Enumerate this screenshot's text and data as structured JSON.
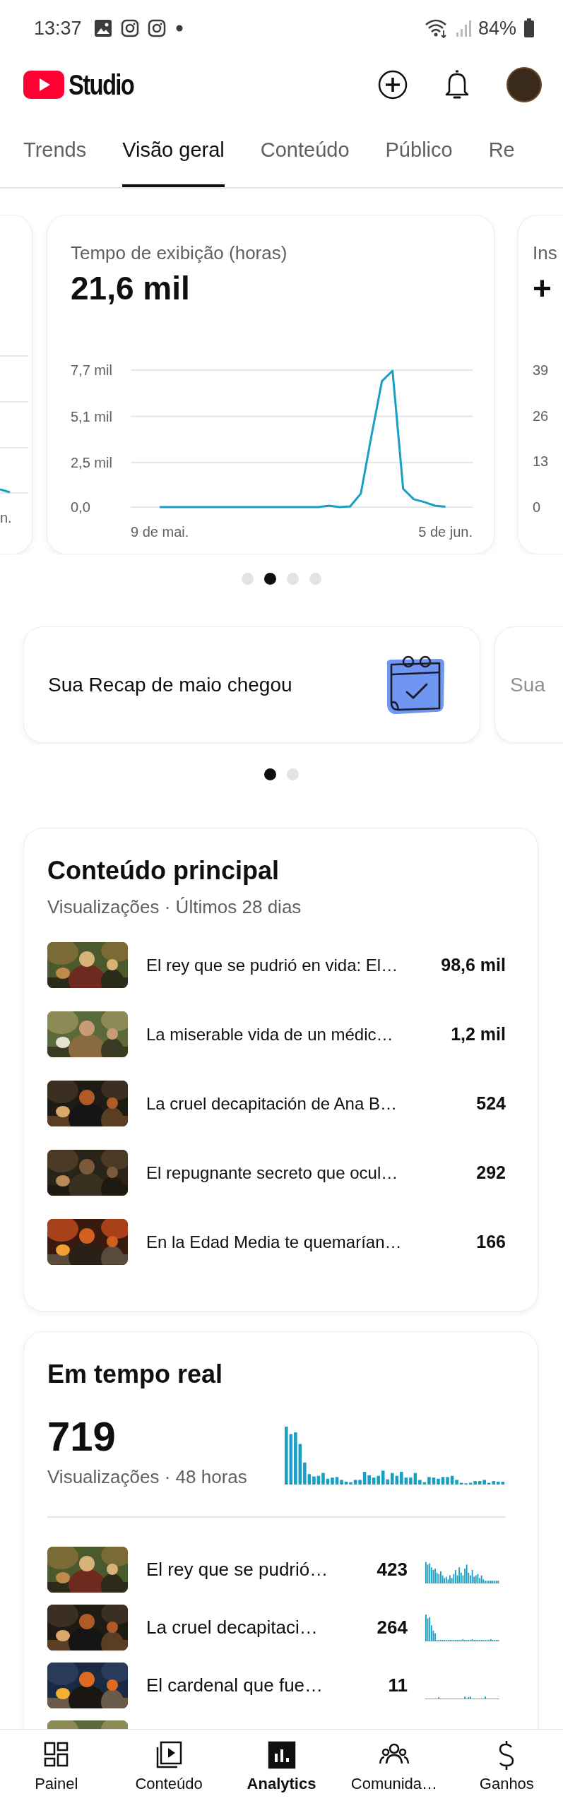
{
  "status_bar": {
    "time": "13:37",
    "battery": "84%"
  },
  "header": {
    "app_name": "Studio"
  },
  "tabs": [
    {
      "label": "Trends",
      "selected": false
    },
    {
      "label": "Visão geral",
      "selected": true
    },
    {
      "label": "Conteúdo",
      "selected": false
    },
    {
      "label": "Público",
      "selected": false
    },
    {
      "label": "Re",
      "selected": false
    }
  ],
  "metric_cards": {
    "left_partial": {
      "x_label": "n."
    },
    "main": {
      "title": "Tempo de exibição (horas)",
      "value": "21,6 mil",
      "chart_data": {
        "type": "line",
        "categories": [
          "9 de mai.",
          null,
          null,
          null,
          null,
          null,
          null,
          null,
          null,
          null,
          null,
          null,
          null,
          null,
          null,
          null,
          null,
          null,
          null,
          null,
          null,
          null,
          null,
          null,
          null,
          null,
          null,
          "5 de jun."
        ],
        "ylim": [
          0,
          7.7
        ],
        "yticks": [
          {
            "value": 0,
            "label": "0,0"
          },
          {
            "value": 2.5,
            "label": "2,5 mil"
          },
          {
            "value": 5.1,
            "label": "5,1 mil"
          },
          {
            "value": 7.7,
            "label": "7,7 mil"
          }
        ],
        "series": [
          {
            "color": "#1a9fc4",
            "values": [
              0,
              0,
              0,
              0,
              0,
              0,
              0,
              0,
              0,
              0,
              0,
              0,
              0,
              0,
              0,
              0,
              0.08,
              0,
              0.04,
              0.76,
              4.0,
              7.08,
              7.66,
              1.03,
              0.44,
              0.28,
              0.08,
              0.02
            ]
          }
        ]
      }
    },
    "right_partial": {
      "title": "Ins",
      "value": "+",
      "tick_labels": [
        "39",
        "26",
        "13",
        "0"
      ]
    }
  },
  "metric_dots": [
    {
      "selected": false
    },
    {
      "selected": true
    },
    {
      "selected": false
    },
    {
      "selected": false
    }
  ],
  "recap": {
    "cards": [
      {
        "kind": "full",
        "title": "Sua Recap de maio chegou"
      },
      {
        "kind": "partial",
        "title": "Sua"
      }
    ],
    "dots": [
      {
        "selected": true
      },
      {
        "selected": false
      }
    ]
  },
  "top_content": {
    "title": "Conteúdo principal",
    "subtitle": "Visualizações · Últimos 28 dias",
    "rows": [
      {
        "title": "El rey que se pudrió en vida: El…",
        "value": "98,6 mil"
      },
      {
        "title": "La miserable vida de un médic…",
        "value": "1,2 mil"
      },
      {
        "title": "La cruel decapitación de Ana B…",
        "value": "524"
      },
      {
        "title": "El repugnante secreto que ocul…",
        "value": "292"
      },
      {
        "title": "En la Edad Media te quemarían…",
        "value": "166"
      }
    ]
  },
  "realtime": {
    "title": "Em tempo real",
    "value": "719",
    "subtitle": "Visualizações · 48 horas",
    "rows": [
      {
        "kind": "video",
        "title": "El rey que se pudrió…",
        "value": "423"
      },
      {
        "kind": "video",
        "title": "La cruel decapitaci…",
        "value": "264"
      },
      {
        "kind": "video",
        "title": "El cardenal que fue…",
        "value": "11"
      },
      {
        "kind": "partial"
      }
    ]
  },
  "bottom_nav": [
    {
      "label": "Painel",
      "selected": false
    },
    {
      "label": "Conteúdo",
      "selected": false
    },
    {
      "label": "Analytics",
      "selected": true
    },
    {
      "label": "Comunida…",
      "selected": false
    },
    {
      "label": "Ganhos",
      "selected": false
    }
  ]
}
